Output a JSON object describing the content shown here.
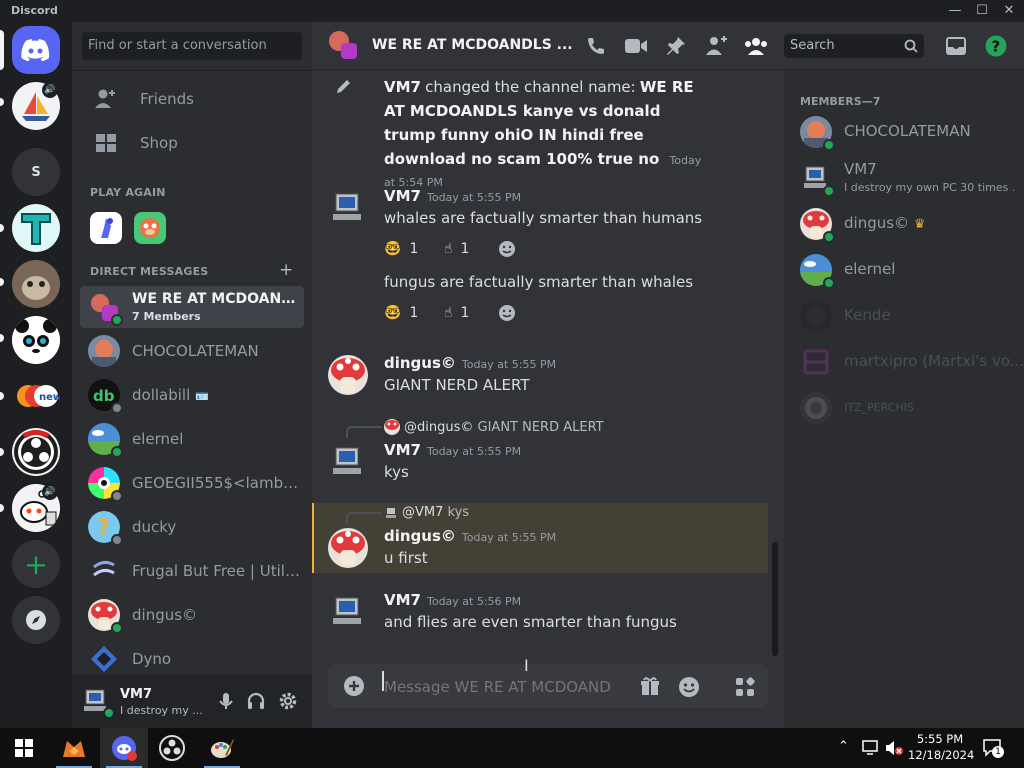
{
  "window": {
    "title": "Discord"
  },
  "sidebar": {
    "search_placeholder": "Find or start a conversation",
    "nav": {
      "friends": "Friends",
      "shop": "Shop"
    },
    "play_again_heading": "PLAY AGAIN",
    "dm_heading": "DIRECT MESSAGES",
    "add_dm": "+",
    "dms": [
      {
        "name": "WE RE AT MCDOAND...",
        "sub": "7 Members",
        "status": "online"
      },
      {
        "name": "CHOCOLATEMAN",
        "status": "none"
      },
      {
        "name": "dollabill",
        "status": "offline"
      },
      {
        "name": "elernel",
        "status": "online"
      },
      {
        "name": "GEOEGII555$<lambd...",
        "status": "offline"
      },
      {
        "name": "ducky",
        "status": "offline"
      },
      {
        "name": "Frugal But Free | Utilit...",
        "status": "none"
      },
      {
        "name": "dingus©",
        "status": "online"
      },
      {
        "name": "Dyno",
        "status": "none"
      }
    ]
  },
  "servers": {
    "s_label": "S"
  },
  "user": {
    "name": "VM7",
    "status_text": "I destroy my ..."
  },
  "channel": {
    "name": "WE RE AT MCDOANDLS ...",
    "search_placeholder": "Search"
  },
  "messages": {
    "system": {
      "actor": "VM7",
      "action": "changed the channel name:",
      "new_name": "WE RE AT MCDOANDLS kanye vs donald trump funny ohiO IN hindi free download no scam 100% true no",
      "time": "Today at 5:54 PM"
    },
    "m1": {
      "author": "VM7",
      "time": "Today at 5:55 PM",
      "text": "whales are factually smarter than humans",
      "reactions": [
        {
          "emoji": "🤓",
          "count": "1"
        },
        {
          "emoji": "☝",
          "count": "1"
        }
      ]
    },
    "m2": {
      "text": "fungus are factually smarter than whales",
      "reactions": [
        {
          "emoji": "🤓",
          "count": "1"
        },
        {
          "emoji": "☝",
          "count": "1"
        }
      ]
    },
    "m3": {
      "author": "dingus©",
      "time": "Today at 5:55 PM",
      "text": "GIANT NERD ALERT"
    },
    "m4": {
      "reply_author": "@dingus©",
      "reply_text": "GIANT NERD ALERT",
      "author": "VM7",
      "time": "Today at 5:55 PM",
      "text": "kys"
    },
    "m5": {
      "reply_author": "@VM7",
      "reply_text": "kys",
      "author": "dingus©",
      "time": "Today at 5:55 PM",
      "text": "u first"
    },
    "m6": {
      "author": "VM7",
      "time": "Today at 5:56 PM",
      "text": "and flies are even smarter than fungus"
    }
  },
  "composer": {
    "placeholder": "Message WE RE AT MCDOAND..."
  },
  "members": {
    "heading": "MEMBERS—7",
    "list": [
      {
        "name": "CHOCOLATEMAN",
        "status": "online"
      },
      {
        "name": "VM7",
        "sub": "I destroy my own PC 30 times ...",
        "status": "online"
      },
      {
        "name": "dingus©",
        "status": "online",
        "owner": true
      },
      {
        "name": "elernel",
        "status": "online"
      },
      {
        "name": "Kende",
        "status": "offline"
      },
      {
        "name": "martxipro (Martxi's vo...",
        "status": "offline"
      },
      {
        "name": "ITZ_PERCHIS",
        "status": "offline"
      }
    ]
  },
  "taskbar": {
    "time": "5:55 PM",
    "date": "12/18/2024",
    "notif_count": "1"
  },
  "colors": {
    "blurple": "#5865f2",
    "online": "#23a55a",
    "highlight": "#f0b232"
  }
}
